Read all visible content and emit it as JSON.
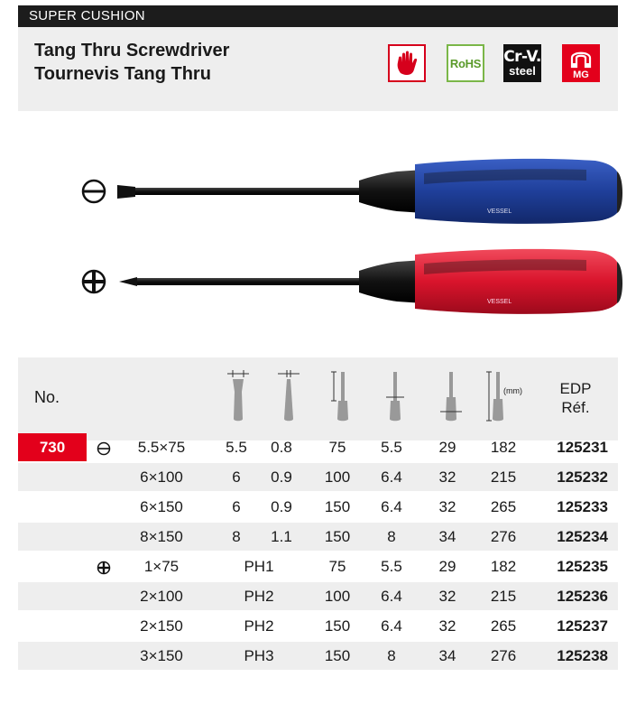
{
  "header": {
    "series_label": "SUPER CUSHION",
    "title_en": "Tang Thru Screwdriver",
    "title_fr": "Tournevis Tang Thru",
    "badges": {
      "rohs": "RoHS",
      "crv_line1": "Cr-V.",
      "crv_line2": "steel",
      "mg": "MG"
    }
  },
  "colors": {
    "accent_red": "#e3001b",
    "band_gray": "#eeeeee",
    "handle_blue": "#1f3f9a",
    "handle_red": "#d9142c"
  },
  "tools": {
    "handle_brand": "VESSEL"
  },
  "table": {
    "head_no": "No.",
    "head_edp_line1": "EDP",
    "head_edp_line2": "Réf.",
    "head_unit": "(mm)",
    "header_icons": [
      "blade-width-icon",
      "blade-thickness-icon",
      "blade-length-icon",
      "shank-diameter-icon",
      "handle-diameter-icon",
      "overall-length-icon"
    ],
    "model_no": "730",
    "rows": [
      {
        "type": "slotted",
        "size": "5.5×75",
        "a": "5.5",
        "b": "0.8",
        "c": "75",
        "d": "5.5",
        "e": "29",
        "f": "182",
        "edp": "125231"
      },
      {
        "type": "",
        "size": "6×100",
        "a": "6",
        "b": "0.9",
        "c": "100",
        "d": "6.4",
        "e": "32",
        "f": "215",
        "edp": "125232"
      },
      {
        "type": "",
        "size": "6×150",
        "a": "6",
        "b": "0.9",
        "c": "150",
        "d": "6.4",
        "e": "32",
        "f": "265",
        "edp": "125233"
      },
      {
        "type": "",
        "size": "8×150",
        "a": "8",
        "b": "1.1",
        "c": "150",
        "d": "8",
        "e": "34",
        "f": "276",
        "edp": "125234"
      },
      {
        "type": "phillips",
        "size": "1×75",
        "ph": "PH1",
        "c": "75",
        "d": "5.5",
        "e": "29",
        "f": "182",
        "edp": "125235"
      },
      {
        "type": "",
        "size": "2×100",
        "ph": "PH2",
        "c": "100",
        "d": "6.4",
        "e": "32",
        "f": "215",
        "edp": "125236"
      },
      {
        "type": "",
        "size": "2×150",
        "ph": "PH2",
        "c": "150",
        "d": "6.4",
        "e": "32",
        "f": "265",
        "edp": "125237"
      },
      {
        "type": "",
        "size": "3×150",
        "ph": "PH3",
        "c": "150",
        "d": "8",
        "e": "34",
        "f": "276",
        "edp": "125238"
      }
    ]
  }
}
